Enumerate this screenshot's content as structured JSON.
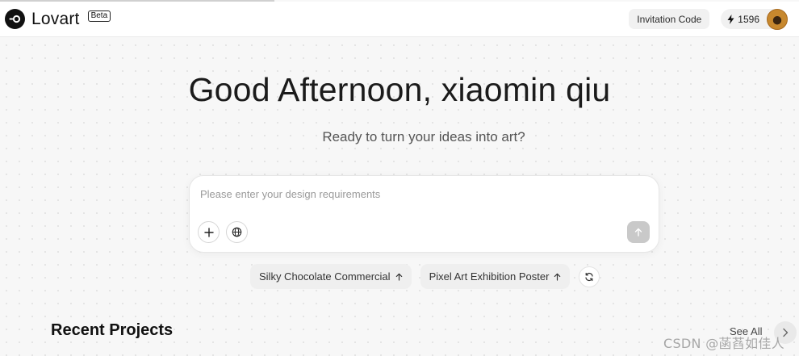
{
  "header": {
    "brand": "Lovart",
    "badge": "Beta",
    "invitation_label": "Invitation Code",
    "credits": "1596"
  },
  "hero": {
    "greeting": "Good Afternoon, xiaomin qiu",
    "subtitle": "Ready to turn your ideas into art?"
  },
  "prompt": {
    "placeholder": "Please enter your design requirements",
    "value": ""
  },
  "suggestions": [
    {
      "label": "Silky Chocolate Commercial"
    },
    {
      "label": "Pixel Art Exhibition Poster"
    }
  ],
  "recent": {
    "title": "Recent Projects",
    "see_all": "See All"
  },
  "watermark": "CSDN @菡萏如佳人",
  "colors": {
    "send_button_disabled": "#c9c9c9",
    "chip_bg": "#efefef"
  },
  "icons": {
    "logo": "lovart-logo-icon",
    "credits": "lightning-icon",
    "add": "plus-icon",
    "web": "globe-icon",
    "send": "arrow-up-icon",
    "suggestion": "arrow-up-icon",
    "refresh": "refresh-icon",
    "next": "chevron-right-icon"
  }
}
